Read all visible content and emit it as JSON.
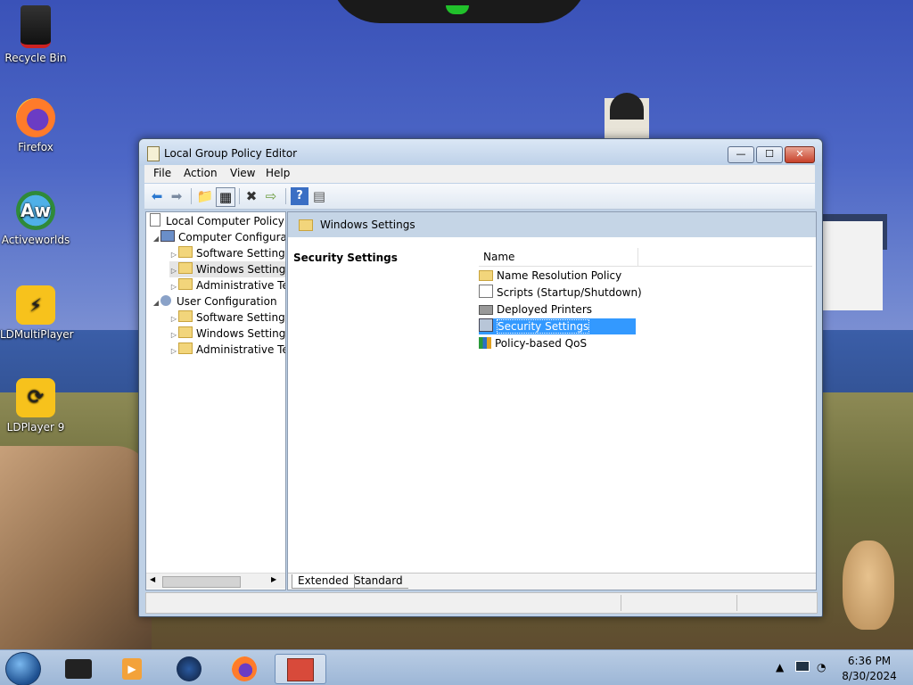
{
  "desktop": {
    "icons": [
      {
        "label": "Recycle Bin",
        "icon": "recycle-bin-icon"
      },
      {
        "label": "Firefox",
        "icon": "firefox-icon"
      },
      {
        "label": "Activeworlds",
        "icon": "activeworlds-icon"
      },
      {
        "label": "LDMultiPlayer",
        "icon": "ldmultiplayer-icon"
      },
      {
        "label": "LDPlayer 9",
        "icon": "ldplayer-icon"
      }
    ]
  },
  "window": {
    "title": "Local Group Policy Editor",
    "controls": {
      "minimize": "—",
      "maximize": "☐",
      "close": "✕"
    },
    "menu": [
      "File",
      "Action",
      "View",
      "Help"
    ],
    "toolbar_icons": [
      "back-arrow-icon",
      "forward-arrow-icon",
      "up-folder-icon",
      "show-hide-tree-icon",
      "delete-icon",
      "export-list-icon",
      "help-icon",
      "properties-icon"
    ],
    "tree": {
      "root": "Local Computer Policy",
      "items": [
        {
          "label": "Computer Configura",
          "level": 1,
          "expanded": true
        },
        {
          "label": "Software Settings",
          "level": 2
        },
        {
          "label": "Windows Setting",
          "level": 2,
          "selected": true
        },
        {
          "label": "Administrative Te",
          "level": 2
        },
        {
          "label": "User Configuration",
          "level": 1,
          "expanded": true
        },
        {
          "label": "Software Settings",
          "level": 2
        },
        {
          "label": "Windows Setting",
          "level": 2
        },
        {
          "label": "Administrative Te",
          "level": 2
        }
      ]
    },
    "right_pane": {
      "header": "Windows Settings",
      "description_title": "Security Settings",
      "column_name": "Name",
      "rows": [
        {
          "label": "Name Resolution Policy",
          "icon": "folder-icon"
        },
        {
          "label": "Scripts (Startup/Shutdown)",
          "icon": "script-icon"
        },
        {
          "label": "Deployed Printers",
          "icon": "printer-icon"
        },
        {
          "label": "Security Settings",
          "icon": "security-icon",
          "selected": true
        },
        {
          "label": "Policy-based QoS",
          "icon": "chart-icon"
        }
      ],
      "tabs": [
        "Extended",
        "Standard"
      ]
    }
  },
  "taskbar": {
    "apps": [
      "folder-explorer-icon",
      "media-player-icon",
      "browser-globe-icon",
      "firefox-icon",
      "group-policy-icon"
    ],
    "clock": {
      "time": "6:36 PM",
      "date": "8/30/2024"
    }
  }
}
